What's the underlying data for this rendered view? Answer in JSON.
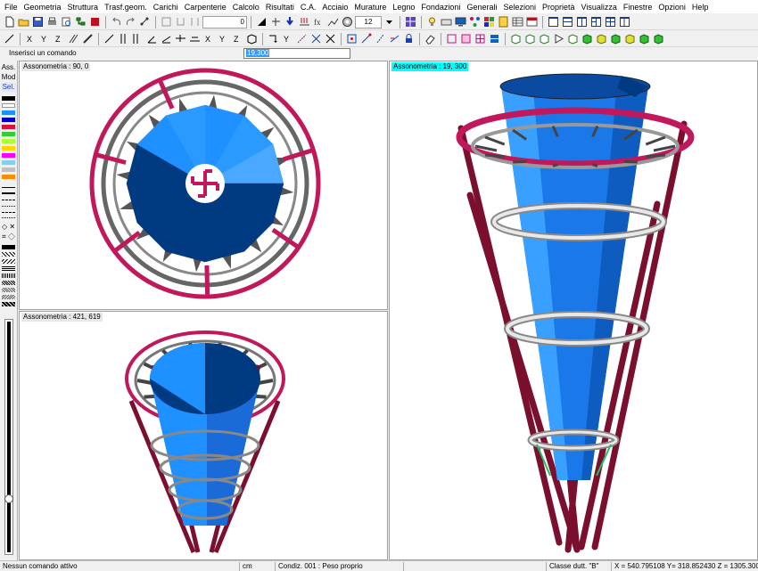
{
  "menu": [
    "File",
    "Geometria",
    "Struttura",
    "Trasf.geom.",
    "Carichi",
    "Carpenterie",
    "Calcolo",
    "Risultati",
    "C.A.",
    "Acciaio",
    "Murature",
    "Legno",
    "Fondazioni",
    "Generali",
    "Selezioni",
    "Proprietà",
    "Visualizza",
    "Finestre",
    "Opzioni",
    "Help"
  ],
  "toolbar": {
    "zoom_combo_value": "0",
    "segments_combo_value": "12"
  },
  "command": {
    "label": "Inserisci un comando",
    "value": "19,300"
  },
  "left_panel": {
    "ass": "Ass.",
    "mod": "Mod",
    "sel": "Sel."
  },
  "palette": [
    "#000000",
    "#ffffff",
    "#1e90ff",
    "#0000cd",
    "#dc143c",
    "#32cd32",
    "#adff2f",
    "#ffd700",
    "#ff00ff",
    "#87ceeb",
    "#c0c0c0",
    "#ff8c00"
  ],
  "viewports": {
    "top_left": {
      "label": "Assonometria :  90, 0"
    },
    "bottom_left": {
      "label": "Assonometria :  421, 619"
    },
    "right": {
      "label": "Assonometria :  19, 300",
      "label_bg": "#00ffff"
    }
  },
  "colors": {
    "ring": "#c0185a",
    "column": "#7a0f2e",
    "cone_light": "#1e90ff",
    "cone_dark": "#003a80",
    "bracket": "#555555"
  },
  "status": {
    "message": "Nessun comando attivo",
    "unit": "cm",
    "condition": "Condiz. 001 : Peso proprio",
    "class": "Classe dutt. \"B\"",
    "coords": "X = 540.795108 Y= 318.852430 Z = 1305.300000"
  }
}
